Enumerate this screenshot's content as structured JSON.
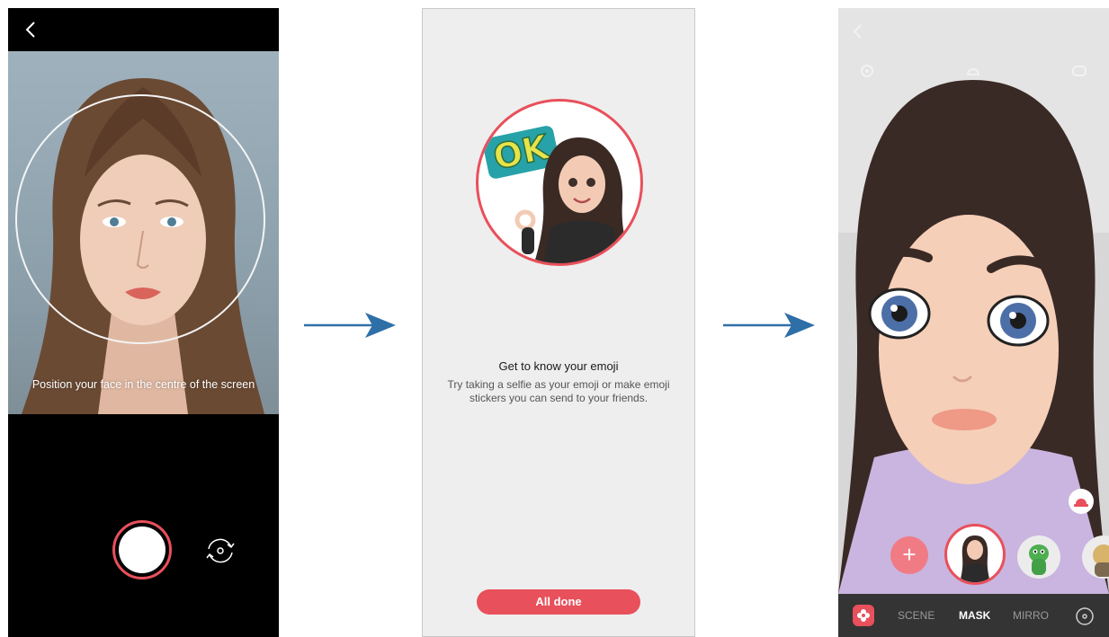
{
  "screen1": {
    "instruction": "Position your face in the centre of the screen",
    "icons": {
      "back": "back-chevron-icon",
      "shutter": "shutter-button",
      "switch": "switch-camera-icon"
    },
    "colors": {
      "accent": "#e8505b",
      "bar": "#000000"
    }
  },
  "screen2": {
    "badge_text": "OK",
    "title": "Get to know your emoji",
    "description": "Try taking a selfie as your emoji or make emoji stickers you can send to your friends.",
    "done_label": "All done",
    "colors": {
      "accent": "#e8505b",
      "background": "#eeeeee"
    }
  },
  "screen3": {
    "modes": [
      "SCENE",
      "MASK",
      "MIRRO"
    ],
    "active_mode": "MASK",
    "add_label": "+",
    "icons": {
      "back": "back-chevron-icon",
      "settings": "settings-icon",
      "effects": "effects-icon",
      "sticker": "sticker-icon",
      "hat": "hat-icon",
      "emoji": "emoji-flower-icon",
      "rotate": "switch-camera-icon"
    }
  },
  "arrows": {
    "color": "#2f6fa8"
  }
}
